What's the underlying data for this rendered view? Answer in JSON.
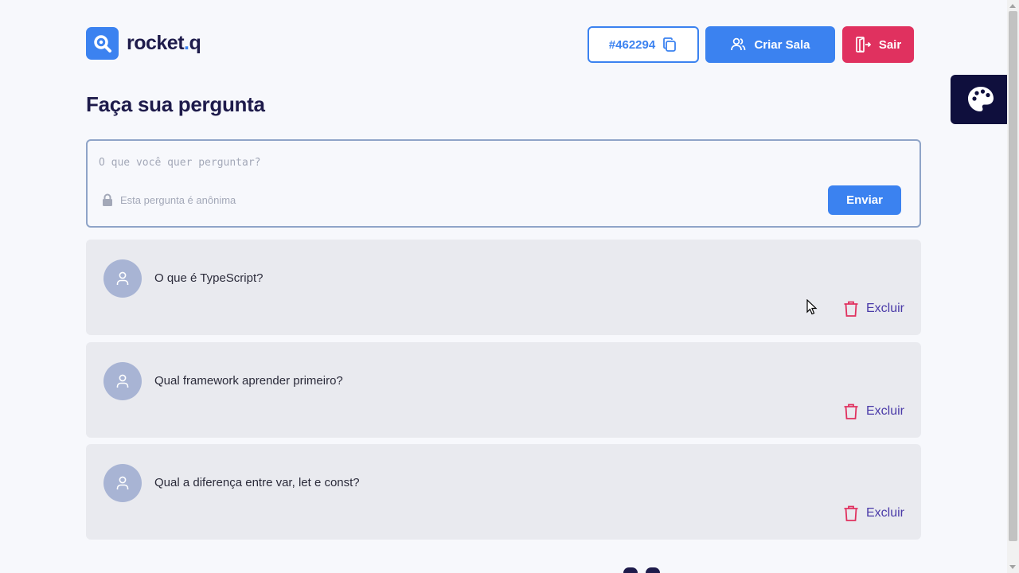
{
  "brand": {
    "name_main": "rocket",
    "name_dot": ".",
    "name_end": "q"
  },
  "header": {
    "room_code": "#462294",
    "create_room_label": "Criar Sala",
    "exit_label": "Sair"
  },
  "page_title": "Faça sua pergunta",
  "form": {
    "placeholder": "O que você quer perguntar?",
    "anonymous_label": "Esta pergunta é anônima",
    "submit_label": "Enviar"
  },
  "questions": [
    {
      "text": "O que é TypeScript?",
      "delete_label": "Excluir"
    },
    {
      "text": "Qual framework aprender primeiro?",
      "delete_label": "Excluir"
    },
    {
      "text": "Qual a diferença entre var, let e const?",
      "delete_label": "Excluir"
    }
  ],
  "icons": {
    "logo": "search-chat-logo-icon",
    "copy": "copy-icon",
    "users": "users-icon",
    "exit": "exit-door-icon",
    "theme": "palette-icon",
    "lock": "lock-icon",
    "user": "user-icon",
    "trash": "trash-icon"
  },
  "colors": {
    "primary": "#3b82f0",
    "danger": "#e0315f",
    "dark": "#1e1b4b",
    "theme_tab": "#0f0f3d",
    "card": "#e9eaef",
    "delete_text": "#4a3aa8"
  }
}
